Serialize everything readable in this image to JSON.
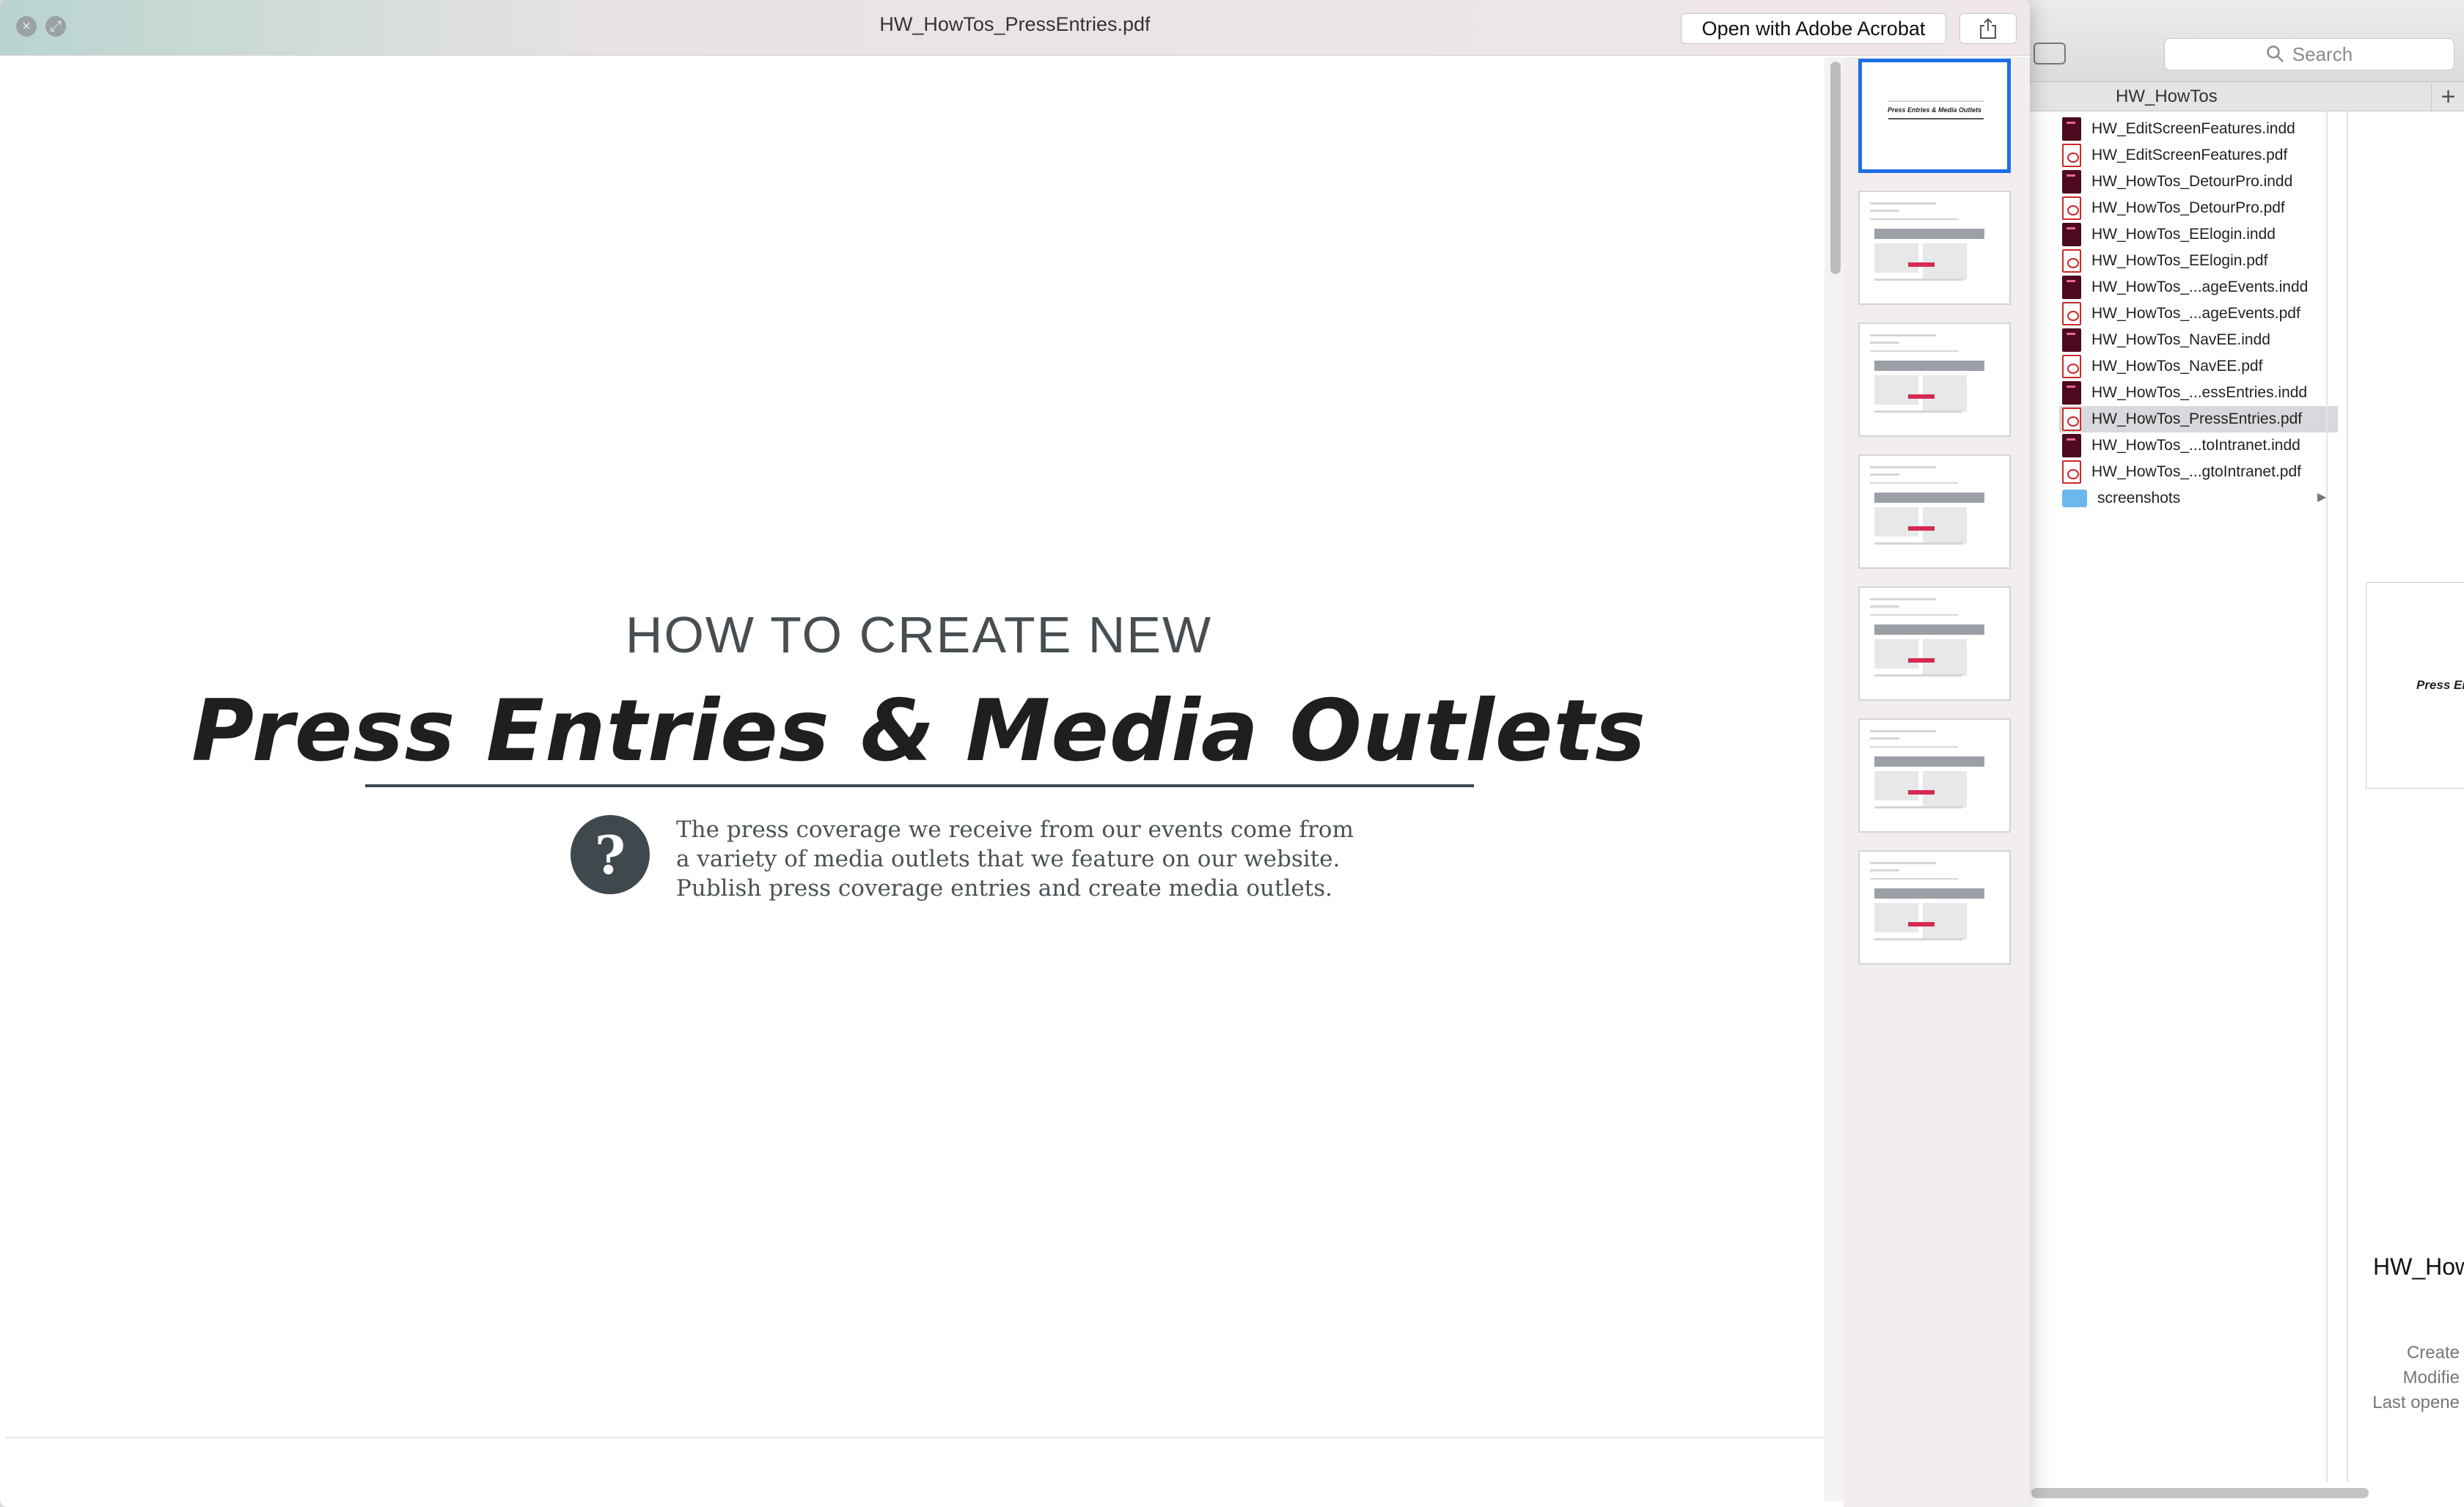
{
  "quicklook": {
    "title": "HW_HowTos_PressEntries.pdf",
    "open_with_label": "Open with Adobe Acrobat",
    "close_icon": "close-icon",
    "fullscreen_icon": "fullscreen-icon",
    "share_icon": "share-icon",
    "document": {
      "kicker": "HOW TO CREATE NEW",
      "title": "Press Entries & Media Outlets",
      "help_glyph": "?",
      "description_lines": [
        "The press coverage we receive from our events come from",
        "a variety of media outlets that we feature on our website.",
        "Publish press coverage entries and create media outlets."
      ]
    },
    "thumbnails": [
      {
        "page": 1,
        "selected": true,
        "thumb_title": "Press Entries & Media Outlets"
      },
      {
        "page": 2,
        "selected": false
      },
      {
        "page": 3,
        "selected": false
      },
      {
        "page": 4,
        "selected": false
      },
      {
        "page": 5,
        "selected": false
      },
      {
        "page": 6,
        "selected": false
      },
      {
        "page": 7,
        "selected": false
      }
    ]
  },
  "finder": {
    "search_placeholder": "Search",
    "path_label": "HW_HowTos",
    "add_label": "+",
    "files": [
      {
        "name": "HW_EditScreenFeatures.indd",
        "type": "indd"
      },
      {
        "name": "HW_EditScreenFeatures.pdf",
        "type": "pdf"
      },
      {
        "name": "HW_HowTos_DetourPro.indd",
        "type": "indd"
      },
      {
        "name": "HW_HowTos_DetourPro.pdf",
        "type": "pdf"
      },
      {
        "name": "HW_HowTos_EElogin.indd",
        "type": "indd"
      },
      {
        "name": "HW_HowTos_EElogin.pdf",
        "type": "pdf"
      },
      {
        "name": "HW_HowTos_...ageEvents.indd",
        "type": "indd"
      },
      {
        "name": "HW_HowTos_...ageEvents.pdf",
        "type": "pdf"
      },
      {
        "name": "HW_HowTos_NavEE.indd",
        "type": "indd"
      },
      {
        "name": "HW_HowTos_NavEE.pdf",
        "type": "pdf"
      },
      {
        "name": "HW_HowTos_...essEntries.indd",
        "type": "indd"
      },
      {
        "name": "HW_HowTos_PressEntries.pdf",
        "type": "pdf",
        "selected": true
      },
      {
        "name": "HW_HowTos_...toIntranet.indd",
        "type": "indd"
      },
      {
        "name": "HW_HowTos_...gtoIntranet.pdf",
        "type": "pdf"
      },
      {
        "name": "screenshots",
        "type": "folder"
      }
    ],
    "preview": {
      "thumb_text": "Press En",
      "name": "HW_How",
      "meta_labels": [
        "Create",
        "Modifie",
        "Last opene"
      ]
    }
  },
  "colors": {
    "selection_blue": "#1e6ee5",
    "indd_icon": "#4d0a1f",
    "pdf_icon": "#c92a2a",
    "folder_icon": "#6cb7ee",
    "doc_dark": "#3f484d"
  }
}
